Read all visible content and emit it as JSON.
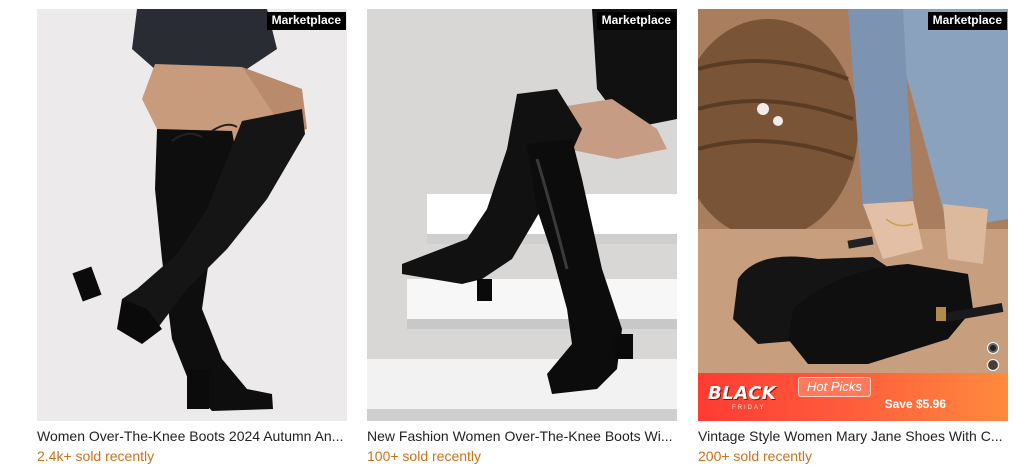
{
  "products": [
    {
      "badge": "Marketplace",
      "title": "Women Over-The-Knee Boots 2024 Autumn An...",
      "sold": "2.4k+ sold recently"
    },
    {
      "badge": "Marketplace",
      "title": "New Fashion Women Over-The-Knee Boots Wi...",
      "sold": "100+ sold recently"
    },
    {
      "badge": "Marketplace",
      "title": "Vintage Style Women Mary Jane Shoes With C...",
      "sold": "200+ sold recently",
      "promo": {
        "event": "BLACK",
        "event_sub": "FRIDAY",
        "tag": "Hot Picks",
        "save": "Save $5.96"
      }
    }
  ],
  "colors": {
    "badge_bg": "#000000",
    "sold_text": "#c9711c",
    "promo_red": "#ff3b32"
  }
}
